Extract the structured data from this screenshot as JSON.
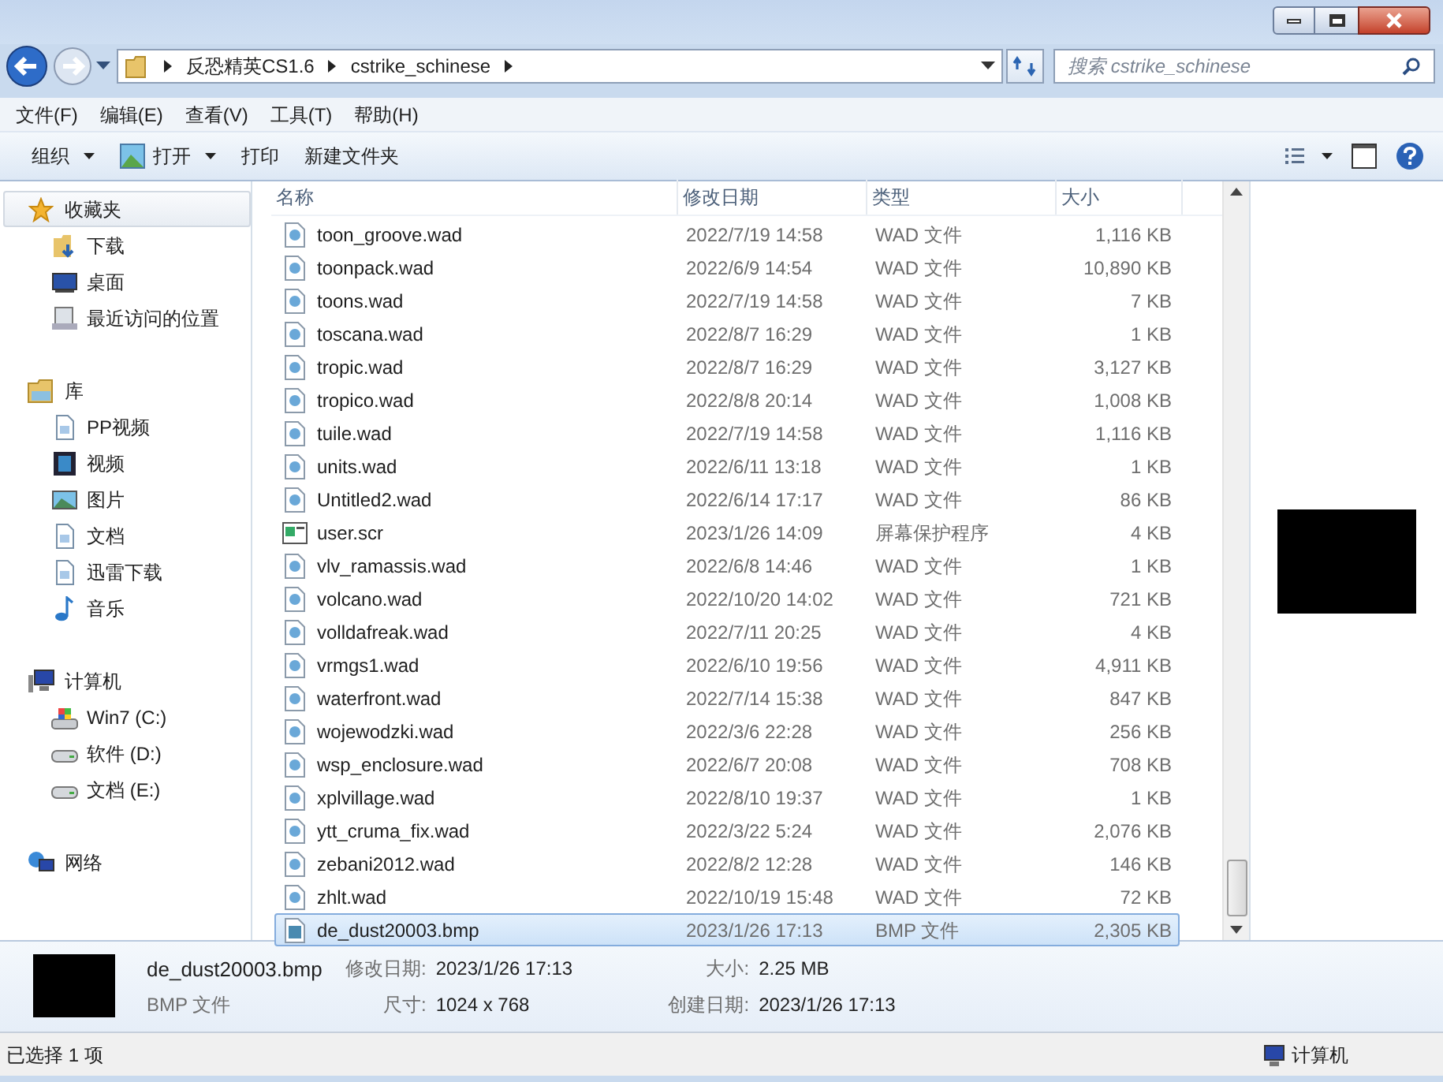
{
  "address": {
    "crumbs": [
      "反恐精英CS1.6",
      "cstrike_schinese"
    ]
  },
  "search": {
    "placeholder": "搜索 cstrike_schinese"
  },
  "menu": [
    "文件(F)",
    "编辑(E)",
    "查看(V)",
    "工具(T)",
    "帮助(H)"
  ],
  "toolbar": [
    {
      "label": "组织",
      "kind": "dropdown"
    },
    {
      "label": "打开",
      "kind": "open"
    },
    {
      "label": "打印",
      "kind": "plain"
    },
    {
      "label": "新建文件夹",
      "kind": "plain"
    }
  ],
  "sidebar": {
    "groups": [
      {
        "label": "收藏夹",
        "kind": "favorites",
        "selected": true,
        "children": [
          {
            "label": "下载",
            "kind": "download"
          },
          {
            "label": "桌面",
            "kind": "desktop"
          },
          {
            "label": "最近访问的位置",
            "kind": "recent"
          }
        ]
      },
      {
        "label": "库",
        "kind": "library",
        "selected": false,
        "children": [
          {
            "label": "PP视频",
            "kind": "doc"
          },
          {
            "label": "视频",
            "kind": "video"
          },
          {
            "label": "图片",
            "kind": "picture"
          },
          {
            "label": "文档",
            "kind": "doc"
          },
          {
            "label": "迅雷下载",
            "kind": "doc"
          },
          {
            "label": "音乐",
            "kind": "music"
          }
        ]
      },
      {
        "label": "计算机",
        "kind": "computer",
        "selected": false,
        "children": [
          {
            "label": "Win7 (C:)",
            "kind": "systemdrive"
          },
          {
            "label": "软件 (D:)",
            "kind": "drive"
          },
          {
            "label": "文档 (E:)",
            "kind": "drive"
          }
        ]
      },
      {
        "label": "网络",
        "kind": "network",
        "selected": false
      }
    ]
  },
  "table": {
    "columns": [
      "名称",
      "修改日期",
      "类型",
      "大小"
    ],
    "rows": [
      {
        "name": "toon_groove.wad",
        "date": "2022/7/19 14:58",
        "type": "WAD 文件",
        "size": "1,116 KB",
        "kind": "wad",
        "selected": false
      },
      {
        "name": "toonpack.wad",
        "date": "2022/6/9 14:54",
        "type": "WAD 文件",
        "size": "10,890 KB",
        "kind": "wad",
        "selected": false
      },
      {
        "name": "toons.wad",
        "date": "2022/7/19 14:58",
        "type": "WAD 文件",
        "size": "7 KB",
        "kind": "wad",
        "selected": false
      },
      {
        "name": "toscana.wad",
        "date": "2022/8/7 16:29",
        "type": "WAD 文件",
        "size": "1 KB",
        "kind": "wad",
        "selected": false
      },
      {
        "name": "tropic.wad",
        "date": "2022/8/7 16:29",
        "type": "WAD 文件",
        "size": "3,127 KB",
        "kind": "wad",
        "selected": false
      },
      {
        "name": "tropico.wad",
        "date": "2022/8/8 20:14",
        "type": "WAD 文件",
        "size": "1,008 KB",
        "kind": "wad",
        "selected": false
      },
      {
        "name": "tuile.wad",
        "date": "2022/7/19 14:58",
        "type": "WAD 文件",
        "size": "1,116 KB",
        "kind": "wad",
        "selected": false
      },
      {
        "name": "units.wad",
        "date": "2022/6/11 13:18",
        "type": "WAD 文件",
        "size": "1 KB",
        "kind": "wad",
        "selected": false
      },
      {
        "name": "Untitled2.wad",
        "date": "2022/6/14 17:17",
        "type": "WAD 文件",
        "size": "86 KB",
        "kind": "wad",
        "selected": false
      },
      {
        "name": "user.scr",
        "date": "2023/1/26 14:09",
        "type": "屏幕保护程序",
        "size": "4 KB",
        "kind": "scr",
        "selected": false
      },
      {
        "name": "vlv_ramassis.wad",
        "date": "2022/6/8 14:46",
        "type": "WAD 文件",
        "size": "1 KB",
        "kind": "wad",
        "selected": false
      },
      {
        "name": "volcano.wad",
        "date": "2022/10/20 14:02",
        "type": "WAD 文件",
        "size": "721 KB",
        "kind": "wad",
        "selected": false
      },
      {
        "name": "volldafreak.wad",
        "date": "2022/7/11 20:25",
        "type": "WAD 文件",
        "size": "4 KB",
        "kind": "wad",
        "selected": false
      },
      {
        "name": "vrmgs1.wad",
        "date": "2022/6/10 19:56",
        "type": "WAD 文件",
        "size": "4,911 KB",
        "kind": "wad",
        "selected": false
      },
      {
        "name": "waterfront.wad",
        "date": "2022/7/14 15:38",
        "type": "WAD 文件",
        "size": "847 KB",
        "kind": "wad",
        "selected": false
      },
      {
        "name": "wojewodzki.wad",
        "date": "2022/3/6 22:28",
        "type": "WAD 文件",
        "size": "256 KB",
        "kind": "wad",
        "selected": false
      },
      {
        "name": "wsp_enclosure.wad",
        "date": "2022/6/7 20:08",
        "type": "WAD 文件",
        "size": "708 KB",
        "kind": "wad",
        "selected": false
      },
      {
        "name": "xplvillage.wad",
        "date": "2022/8/10 19:37",
        "type": "WAD 文件",
        "size": "1 KB",
        "kind": "wad",
        "selected": false
      },
      {
        "name": "ytt_cruma_fix.wad",
        "date": "2022/3/22 5:24",
        "type": "WAD 文件",
        "size": "2,076 KB",
        "kind": "wad",
        "selected": false
      },
      {
        "name": "zebani2012.wad",
        "date": "2022/8/2 12:28",
        "type": "WAD 文件",
        "size": "146 KB",
        "kind": "wad",
        "selected": false
      },
      {
        "name": "zhlt.wad",
        "date": "2022/10/19 15:48",
        "type": "WAD 文件",
        "size": "72 KB",
        "kind": "wad",
        "selected": false
      },
      {
        "name": "de_dust20003.bmp",
        "date": "2023/1/26 17:13",
        "type": "BMP 文件",
        "size": "2,305 KB",
        "kind": "bmp",
        "selected": true
      }
    ]
  },
  "details": {
    "name": "de_dust20003.bmp",
    "type": "BMP 文件",
    "fields": [
      {
        "label": "修改日期:",
        "value": "2023/1/26 17:13"
      },
      {
        "label": "尺寸:",
        "value": "1024 x 768"
      },
      {
        "label": "大小:",
        "value": "2.25 MB"
      },
      {
        "label": "创建日期:",
        "value": "2023/1/26 17:13"
      }
    ]
  },
  "status_bar": {
    "selection": "已选择 1 项",
    "location": "计算机"
  }
}
